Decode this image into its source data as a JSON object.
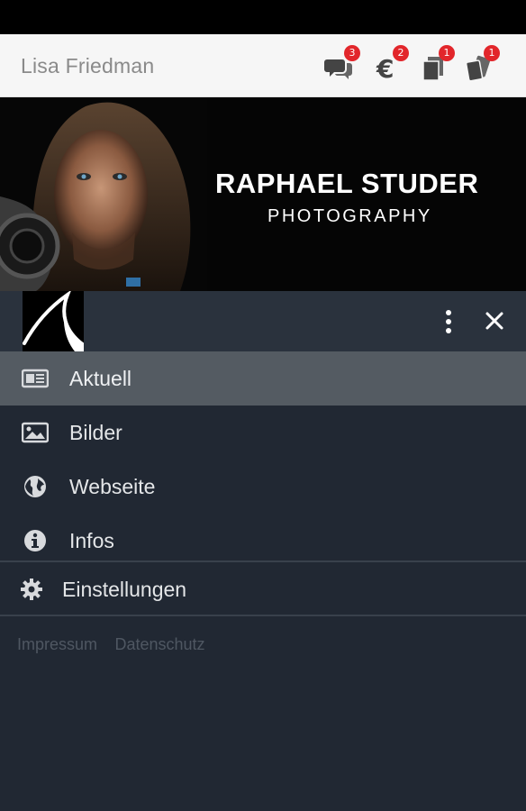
{
  "topbar": {
    "user_name": "Lisa Friedman",
    "icons": [
      {
        "name": "chat-icon",
        "badge": "3"
      },
      {
        "name": "euro-icon",
        "badge": "2"
      },
      {
        "name": "documents-icon",
        "badge": "1"
      },
      {
        "name": "cards-icon",
        "badge": "1"
      }
    ]
  },
  "banner": {
    "title": "RAPHAEL STUDER",
    "subtitle": "PHOTOGRAPHY"
  },
  "drawer": {
    "nav": [
      {
        "label": "Aktuell",
        "icon": "newspaper-icon",
        "active": true
      },
      {
        "label": "Bilder",
        "icon": "image-icon",
        "active": false
      },
      {
        "label": "Webseite",
        "icon": "globe-icon",
        "active": false
      },
      {
        "label": "Infos",
        "icon": "info-icon",
        "active": false
      }
    ],
    "settings_label": "Einstellungen",
    "footer_links": [
      "Impressum",
      "Datenschutz"
    ]
  },
  "colors": {
    "badge": "#e2262b",
    "drawer_bg": "#212833",
    "active_item": "#545b62"
  }
}
